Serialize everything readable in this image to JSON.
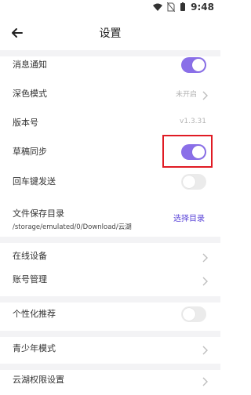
{
  "status": {
    "time": "9:48"
  },
  "header": {
    "title": "设置"
  },
  "rows": [
    {
      "label": "消息通知"
    },
    {
      "label": "深色模式",
      "value": "未开启"
    },
    {
      "label": "版本号",
      "value": "v1.3.31"
    },
    {
      "label": "草稿同步"
    },
    {
      "label": "回车键发送"
    }
  ],
  "storage": {
    "label": "文件保存目录",
    "path": "/storage/emulated/0/Download/云湖",
    "action": "选择目录"
  },
  "rows2": [
    {
      "label": "在线设备"
    },
    {
      "label": "账号管理"
    }
  ],
  "rows3": [
    {
      "label": "个性化推荐"
    }
  ],
  "rows4": [
    {
      "label": "青少年模式"
    }
  ],
  "rows5": [
    {
      "label": "云湖权限设置"
    }
  ],
  "colors": {
    "accent": "#8a6fe8",
    "link": "#5b45d8",
    "highlight": "#e01b24"
  }
}
